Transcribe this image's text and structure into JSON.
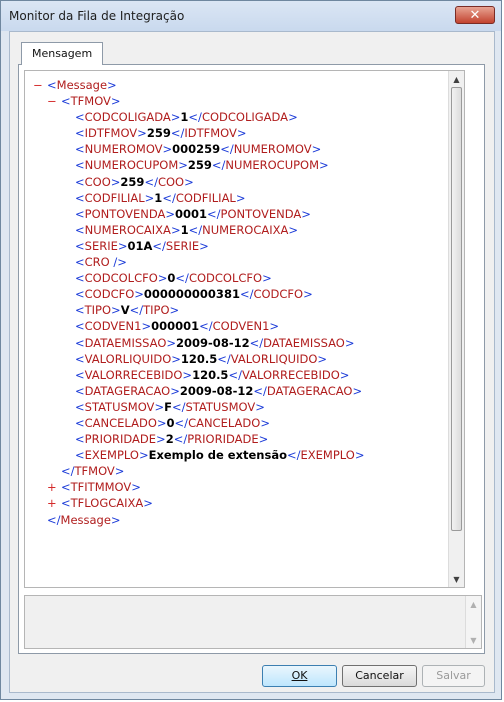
{
  "window": {
    "title": "Monitor da Fila de Integração",
    "close_icon": "close-icon"
  },
  "tabs": [
    {
      "label": "Mensagem",
      "active": true
    }
  ],
  "xml": {
    "root_toggle": "−",
    "root_open": "<Message>",
    "root_close": "</Message>",
    "tfmov_toggle": "−",
    "tfmov_open": "<TFMOV>",
    "tfmov_close": "</TFMOV>",
    "fields": [
      {
        "name": "CODCOLIGADA",
        "value": "1"
      },
      {
        "name": "IDTFMOV",
        "value": "259"
      },
      {
        "name": "NUMEROMOV",
        "value": "000259"
      },
      {
        "name": "NUMEROCUPOM",
        "value": "259"
      },
      {
        "name": "COO",
        "value": "259"
      },
      {
        "name": "CODFILIAL",
        "value": "1"
      },
      {
        "name": "PONTOVENDA",
        "value": "0001"
      },
      {
        "name": "NUMEROCAIXA",
        "value": "1"
      },
      {
        "name": "SERIE",
        "value": "01A"
      },
      {
        "name": "CRO",
        "value": "",
        "empty": true
      },
      {
        "name": "CODCOLCFO",
        "value": "0"
      },
      {
        "name": "CODCFO",
        "value": "000000000381"
      },
      {
        "name": "TIPO",
        "value": "V"
      },
      {
        "name": "CODVEN1",
        "value": "000001"
      },
      {
        "name": "DATAEMISSAO",
        "value": "2009-08-12"
      },
      {
        "name": "VALORLIQUIDO",
        "value": "120.5"
      },
      {
        "name": "VALORRECEBIDO",
        "value": "120.5"
      },
      {
        "name": "DATAGERACAO",
        "value": "2009-08-12"
      },
      {
        "name": "STATUSMOV",
        "value": "F"
      },
      {
        "name": "CANCELADO",
        "value": "0"
      },
      {
        "name": "PRIORIDADE",
        "value": "2"
      },
      {
        "name": "EXEMPLO",
        "value": "Exemplo de extensão"
      }
    ],
    "collapsed": [
      {
        "toggle": "+",
        "tag": "<TFITMMOV>"
      },
      {
        "toggle": "+",
        "tag": "<TFLOGCAIXA>"
      }
    ],
    "colors": {
      "bracket": "#1b3bd8",
      "tag_name": "#b01d1d",
      "toggle": "#d42a2a"
    }
  },
  "buttons": {
    "ok": "OK",
    "cancel": "Cancelar",
    "save": "Salvar"
  },
  "scroll": {
    "up_icon": "▲",
    "down_icon": "▼"
  }
}
